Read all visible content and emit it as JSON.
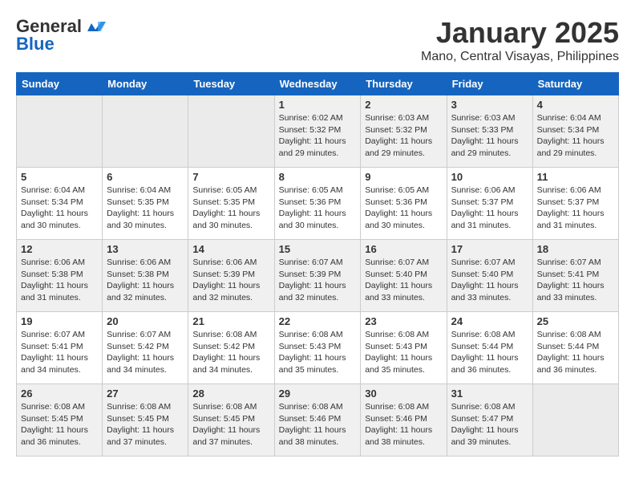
{
  "header": {
    "logo_general": "General",
    "logo_blue": "Blue",
    "month_title": "January 2025",
    "location": "Mano, Central Visayas, Philippines"
  },
  "days_of_week": [
    "Sunday",
    "Monday",
    "Tuesday",
    "Wednesday",
    "Thursday",
    "Friday",
    "Saturday"
  ],
  "weeks": [
    [
      {
        "day": "",
        "info": ""
      },
      {
        "day": "",
        "info": ""
      },
      {
        "day": "",
        "info": ""
      },
      {
        "day": "1",
        "info": "Sunrise: 6:02 AM\nSunset: 5:32 PM\nDaylight: 11 hours and 29 minutes."
      },
      {
        "day": "2",
        "info": "Sunrise: 6:03 AM\nSunset: 5:32 PM\nDaylight: 11 hours and 29 minutes."
      },
      {
        "day": "3",
        "info": "Sunrise: 6:03 AM\nSunset: 5:33 PM\nDaylight: 11 hours and 29 minutes."
      },
      {
        "day": "4",
        "info": "Sunrise: 6:04 AM\nSunset: 5:34 PM\nDaylight: 11 hours and 29 minutes."
      }
    ],
    [
      {
        "day": "5",
        "info": "Sunrise: 6:04 AM\nSunset: 5:34 PM\nDaylight: 11 hours and 30 minutes."
      },
      {
        "day": "6",
        "info": "Sunrise: 6:04 AM\nSunset: 5:35 PM\nDaylight: 11 hours and 30 minutes."
      },
      {
        "day": "7",
        "info": "Sunrise: 6:05 AM\nSunset: 5:35 PM\nDaylight: 11 hours and 30 minutes."
      },
      {
        "day": "8",
        "info": "Sunrise: 6:05 AM\nSunset: 5:36 PM\nDaylight: 11 hours and 30 minutes."
      },
      {
        "day": "9",
        "info": "Sunrise: 6:05 AM\nSunset: 5:36 PM\nDaylight: 11 hours and 30 minutes."
      },
      {
        "day": "10",
        "info": "Sunrise: 6:06 AM\nSunset: 5:37 PM\nDaylight: 11 hours and 31 minutes."
      },
      {
        "day": "11",
        "info": "Sunrise: 6:06 AM\nSunset: 5:37 PM\nDaylight: 11 hours and 31 minutes."
      }
    ],
    [
      {
        "day": "12",
        "info": "Sunrise: 6:06 AM\nSunset: 5:38 PM\nDaylight: 11 hours and 31 minutes."
      },
      {
        "day": "13",
        "info": "Sunrise: 6:06 AM\nSunset: 5:38 PM\nDaylight: 11 hours and 32 minutes."
      },
      {
        "day": "14",
        "info": "Sunrise: 6:06 AM\nSunset: 5:39 PM\nDaylight: 11 hours and 32 minutes."
      },
      {
        "day": "15",
        "info": "Sunrise: 6:07 AM\nSunset: 5:39 PM\nDaylight: 11 hours and 32 minutes."
      },
      {
        "day": "16",
        "info": "Sunrise: 6:07 AM\nSunset: 5:40 PM\nDaylight: 11 hours and 33 minutes."
      },
      {
        "day": "17",
        "info": "Sunrise: 6:07 AM\nSunset: 5:40 PM\nDaylight: 11 hours and 33 minutes."
      },
      {
        "day": "18",
        "info": "Sunrise: 6:07 AM\nSunset: 5:41 PM\nDaylight: 11 hours and 33 minutes."
      }
    ],
    [
      {
        "day": "19",
        "info": "Sunrise: 6:07 AM\nSunset: 5:41 PM\nDaylight: 11 hours and 34 minutes."
      },
      {
        "day": "20",
        "info": "Sunrise: 6:07 AM\nSunset: 5:42 PM\nDaylight: 11 hours and 34 minutes."
      },
      {
        "day": "21",
        "info": "Sunrise: 6:08 AM\nSunset: 5:42 PM\nDaylight: 11 hours and 34 minutes."
      },
      {
        "day": "22",
        "info": "Sunrise: 6:08 AM\nSunset: 5:43 PM\nDaylight: 11 hours and 35 minutes."
      },
      {
        "day": "23",
        "info": "Sunrise: 6:08 AM\nSunset: 5:43 PM\nDaylight: 11 hours and 35 minutes."
      },
      {
        "day": "24",
        "info": "Sunrise: 6:08 AM\nSunset: 5:44 PM\nDaylight: 11 hours and 36 minutes."
      },
      {
        "day": "25",
        "info": "Sunrise: 6:08 AM\nSunset: 5:44 PM\nDaylight: 11 hours and 36 minutes."
      }
    ],
    [
      {
        "day": "26",
        "info": "Sunrise: 6:08 AM\nSunset: 5:45 PM\nDaylight: 11 hours and 36 minutes."
      },
      {
        "day": "27",
        "info": "Sunrise: 6:08 AM\nSunset: 5:45 PM\nDaylight: 11 hours and 37 minutes."
      },
      {
        "day": "28",
        "info": "Sunrise: 6:08 AM\nSunset: 5:45 PM\nDaylight: 11 hours and 37 minutes."
      },
      {
        "day": "29",
        "info": "Sunrise: 6:08 AM\nSunset: 5:46 PM\nDaylight: 11 hours and 38 minutes."
      },
      {
        "day": "30",
        "info": "Sunrise: 6:08 AM\nSunset: 5:46 PM\nDaylight: 11 hours and 38 minutes."
      },
      {
        "day": "31",
        "info": "Sunrise: 6:08 AM\nSunset: 5:47 PM\nDaylight: 11 hours and 39 minutes."
      },
      {
        "day": "",
        "info": ""
      }
    ]
  ]
}
